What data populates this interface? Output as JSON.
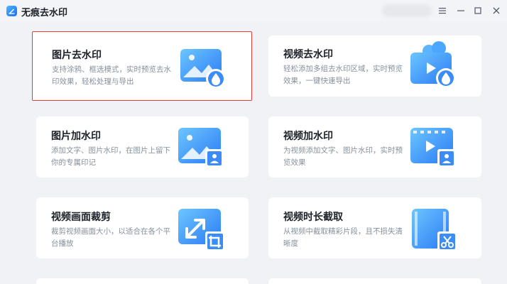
{
  "app": {
    "title": "无痕去水印",
    "window_controls": [
      "menu",
      "minimize",
      "maximize",
      "close"
    ]
  },
  "accent": "#1f6cf2",
  "selected_border": "#e03a3a",
  "cards": [
    {
      "title": "图片去水印",
      "desc_line1": "支持涂鸦、框选模式，实时预览去水",
      "desc_line2": "印效果，轻松处理与导出",
      "icon": "image-remove-watermark-icon",
      "selected": true
    },
    {
      "title": "视频去水印",
      "desc_line1": "轻松添加多组去水印区域，实时预览",
      "desc_line2": "效果，一键快速导出",
      "icon": "video-remove-watermark-icon",
      "selected": false
    },
    {
      "title": "图片加水印",
      "desc_line1": "添加文字、图片水印，在图片上留下",
      "desc_line2": "你的专属印记",
      "icon": "image-add-watermark-icon",
      "selected": false
    },
    {
      "title": "视频加水印",
      "desc_line1": "为视频添加文字、图片水印，实时预",
      "desc_line2": "览效果",
      "icon": "video-add-watermark-icon",
      "selected": false
    },
    {
      "title": "视频画面裁剪",
      "desc_line1": "裁剪视频画面大小，以适合在各个平",
      "desc_line2": "台播放",
      "icon": "video-crop-icon",
      "selected": false
    },
    {
      "title": "视频时长截取",
      "desc_line1": "从视频中截取精彩片段，且不损失清",
      "desc_line2": "晰度",
      "icon": "video-trim-icon",
      "selected": false
    }
  ]
}
